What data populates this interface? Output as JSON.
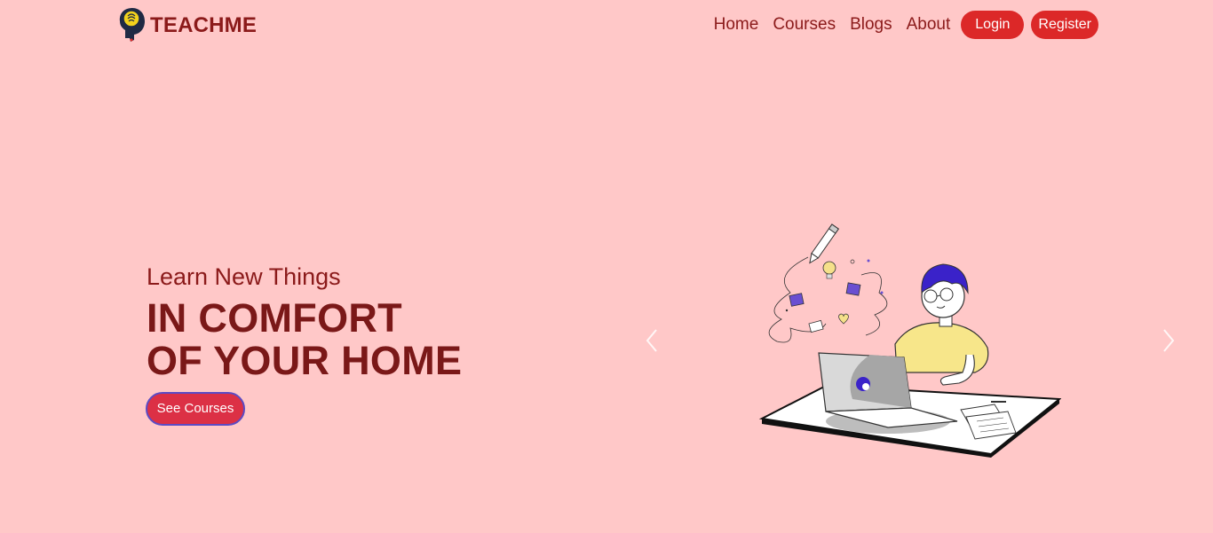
{
  "brand": {
    "name": "TEACHME",
    "logo_icon": "head-lightbulb-icon"
  },
  "nav": {
    "links": [
      "Home",
      "Courses",
      "Blogs",
      "About"
    ],
    "login_label": "Login",
    "register_label": "Register"
  },
  "hero": {
    "subtitle": "Learn New Things",
    "headline_line1": "IN COMFORT",
    "headline_line2": "OF YOUR HOME",
    "cta_label": "See Courses"
  },
  "carousel": {
    "prev_icon": "chevron-left-icon",
    "next_icon": "chevron-right-icon"
  },
  "colors": {
    "background": "#ffc8c8",
    "brand_text": "#8b1a1a",
    "button_red": "#dc2828",
    "cta_border": "#5b4bc4"
  }
}
